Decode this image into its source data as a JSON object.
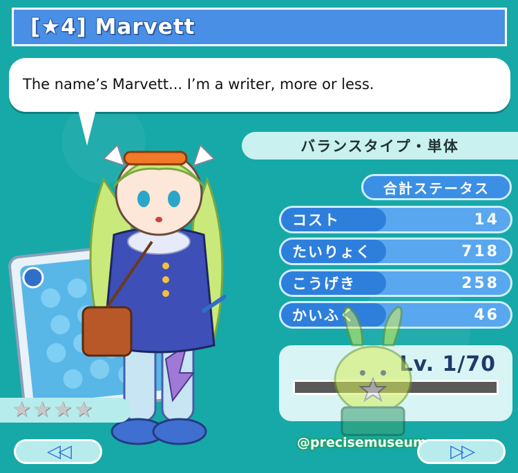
{
  "header": {
    "title": "[★4]  Marvett"
  },
  "dialogue": {
    "quote": "The name’s Marvett... I’m a writer, more or less."
  },
  "character": {
    "type_label": "バランスタイプ・単体"
  },
  "stats": {
    "header": "合計ステータス",
    "rows": [
      {
        "label": "コスト",
        "value": "14"
      },
      {
        "label": "たいりょく",
        "value": "718"
      },
      {
        "label": "こうげき",
        "value": "258"
      },
      {
        "label": "かいふく",
        "value": "46"
      }
    ]
  },
  "level": {
    "text": "Lv. 1/70",
    "progress": 0.0
  },
  "rarity": {
    "stars": 4
  },
  "navigation": {
    "prev_label": "◁◁",
    "next_label": "▷▷"
  },
  "watermark": {
    "handle": "@precisemuseum"
  },
  "colors": {
    "background": "#16a9a8",
    "title_bar": "#4a8fe6",
    "stat_label": "#2e7fdc",
    "stat_row": "#58a7ef"
  }
}
